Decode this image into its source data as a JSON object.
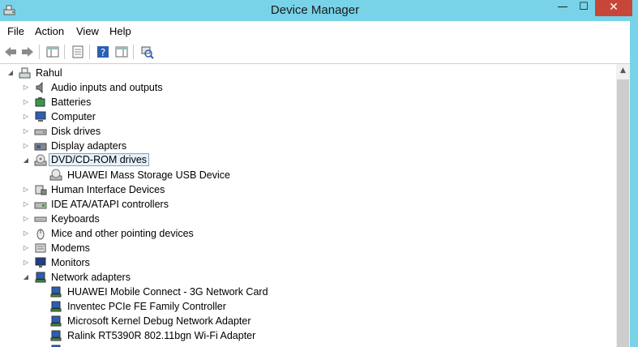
{
  "window": {
    "title": "Device Manager",
    "minimize_glyph": "—",
    "maximize_glyph": "☐",
    "close_glyph": "✕"
  },
  "menu": [
    "File",
    "Action",
    "View",
    "Help"
  ],
  "toolbar": {
    "icons": [
      "back-arrow-icon",
      "forward-arrow-icon",
      "show-hide-console-tree-icon",
      "properties-icon",
      "help-icon",
      "action-pane-icon",
      "scan-hardware-changes-icon"
    ]
  },
  "tree": {
    "root": {
      "label": "Rahul",
      "icon": "computer-network-icon",
      "expanded": true
    },
    "items": [
      {
        "label": "Audio inputs and outputs",
        "icon": "speaker-icon",
        "expanded": false
      },
      {
        "label": "Batteries",
        "icon": "battery-icon",
        "expanded": false
      },
      {
        "label": "Computer",
        "icon": "computer-icon",
        "expanded": false
      },
      {
        "label": "Disk drives",
        "icon": "disk-drive-icon",
        "expanded": false
      },
      {
        "label": "Display adapters",
        "icon": "display-adapter-icon",
        "expanded": false
      },
      {
        "label": "DVD/CD-ROM drives",
        "icon": "dvd-drive-icon",
        "expanded": true,
        "selected": true,
        "children": [
          {
            "label": "HUAWEI Mass Storage USB Device",
            "icon": "dvd-drive-icon"
          }
        ]
      },
      {
        "label": "Human Interface Devices",
        "icon": "hid-icon",
        "expanded": false
      },
      {
        "label": "IDE ATA/ATAPI controllers",
        "icon": "ide-controller-icon",
        "expanded": false
      },
      {
        "label": "Keyboards",
        "icon": "keyboard-icon",
        "expanded": false
      },
      {
        "label": "Mice and other pointing devices",
        "icon": "mouse-icon",
        "expanded": false
      },
      {
        "label": "Modems",
        "icon": "modem-icon",
        "expanded": false
      },
      {
        "label": "Monitors",
        "icon": "monitor-icon",
        "expanded": false
      },
      {
        "label": "Network adapters",
        "icon": "network-adapter-icon",
        "expanded": true,
        "children": [
          {
            "label": "HUAWEI Mobile Connect - 3G Network Card",
            "icon": "network-adapter-icon"
          },
          {
            "label": "Inventec PCIe FE Family Controller",
            "icon": "network-adapter-icon"
          },
          {
            "label": "Microsoft Kernel Debug Network Adapter",
            "icon": "network-adapter-icon"
          },
          {
            "label": "Ralink RT5390R 802.11bgn Wi-Fi Adapter",
            "icon": "network-adapter-icon"
          },
          {
            "label": "",
            "icon": "network-adapter-icon"
          }
        ]
      }
    ]
  },
  "colors": {
    "titlebar": "#78d3e8",
    "close_button": "#c7463a",
    "selection_border": "#7da2ce"
  }
}
